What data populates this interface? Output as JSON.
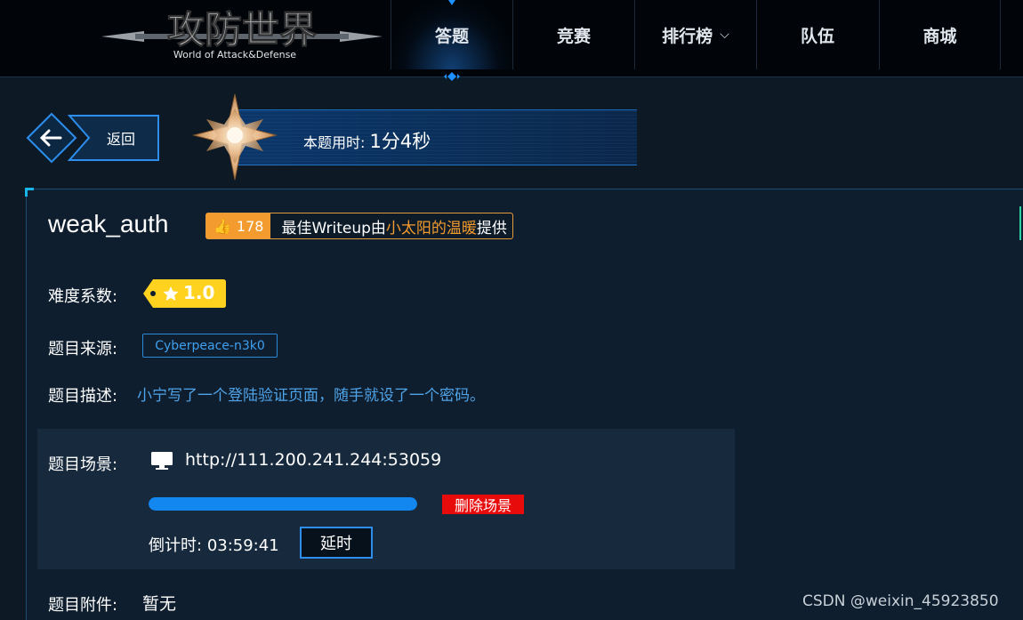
{
  "header": {
    "logo_title": "攻防世界",
    "logo_subtitle": "World of Attack&Defense",
    "nav": [
      {
        "label": "答题",
        "active": true
      },
      {
        "label": "竞赛",
        "active": false
      },
      {
        "label": "排行榜",
        "active": false,
        "has_dropdown": true
      },
      {
        "label": "队伍",
        "active": false
      },
      {
        "label": "商城",
        "active": false
      }
    ]
  },
  "back_button": {
    "label": "返回"
  },
  "timer": {
    "label": "本题用时:",
    "value": "1分4秒"
  },
  "challenge": {
    "title": "weak_auth",
    "likes": "178",
    "writeup_prefix": "最佳Writeup由",
    "writeup_author": "小太阳的温暖",
    "writeup_suffix": "提供",
    "difficulty_label": "难度系数:",
    "difficulty_value": "1.0",
    "source_label": "题目来源:",
    "source_value": "Cyberpeace-n3k0",
    "description_label": "题目描述:",
    "description_value": "小宁写了一个登陆验证页面，随手就设了一个密码。",
    "scene_label": "题目场景:",
    "scene_url": "http://111.200.241.244:53059",
    "scene_progress": 1.0,
    "delete_button": "删除场景",
    "countdown_label": "倒计时:",
    "countdown_value": "03:59:41",
    "extend_button": "延时",
    "attachment_label": "题目附件:",
    "attachment_value": "暂无"
  },
  "watermark": "CSDN @weixin_45923850",
  "colors": {
    "accent_blue": "#1387f0",
    "orange": "#f39b2e",
    "danger": "#e80b0b",
    "difficulty_yellow": "#ffd21f"
  }
}
